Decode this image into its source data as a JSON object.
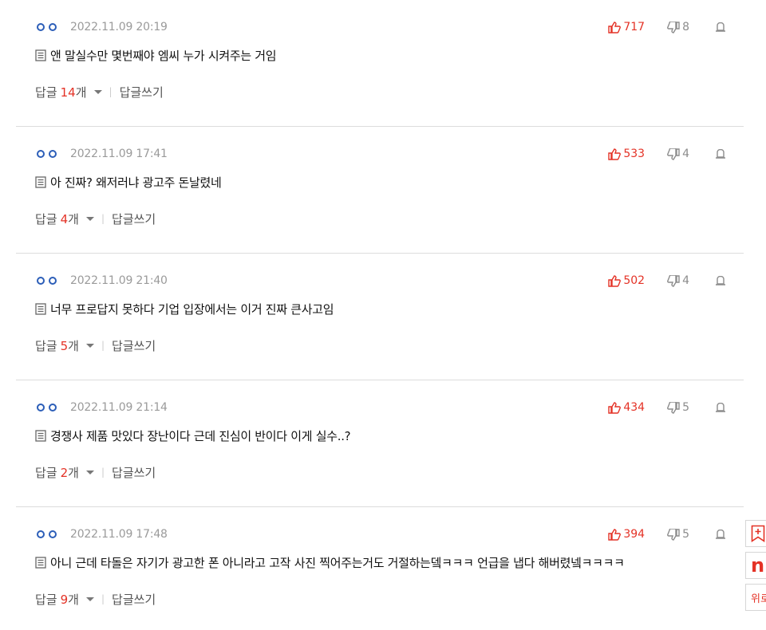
{
  "comments": [
    {
      "date": "2022.11.09 20:19",
      "text": "앤 말실수만 몇번째야 엠씨 누가 시켜주는 거임",
      "likes": "717",
      "dislikes": "8",
      "reply_label": "답글",
      "reply_count": "14",
      "reply_unit": "개",
      "write_reply": "답글쓰기"
    },
    {
      "date": "2022.11.09 17:41",
      "text": "아 진짜? 왜저러냐 광고주 돈날렸네",
      "likes": "533",
      "dislikes": "4",
      "reply_label": "답글",
      "reply_count": "4",
      "reply_unit": "개",
      "write_reply": "답글쓰기"
    },
    {
      "date": "2022.11.09 21:40",
      "text": "너무 프로답지 못하다 기업 입장에서는 이거 진짜 큰사고임",
      "likes": "502",
      "dislikes": "4",
      "reply_label": "답글",
      "reply_count": "5",
      "reply_unit": "개",
      "write_reply": "답글쓰기"
    },
    {
      "date": "2022.11.09 21:14",
      "text": "경쟁사 제품 맛있다 장난이다 근데 진심이 반이다 이게 실수..?",
      "likes": "434",
      "dislikes": "5",
      "reply_label": "답글",
      "reply_count": "2",
      "reply_unit": "개",
      "write_reply": "답글쓰기"
    },
    {
      "date": "2022.11.09 17:48",
      "text": "아니 근데 타돌은 자기가 광고한 폰 아니라고 고작 사진 찍어주는거도 거절하는뎈ㅋㅋㅋ 언급을 냅다 해버렸넼ㅋㅋㅋㅋ",
      "likes": "394",
      "dislikes": "5",
      "reply_label": "답글",
      "reply_count": "9",
      "reply_unit": "개",
      "write_reply": "답글쓰기"
    }
  ],
  "side_tools": {
    "bookmark_icon": "bookmark-plus-icon",
    "naver_logo": "n",
    "third_label": "위로"
  },
  "colors": {
    "accent": "#e43226",
    "nick_blue": "#2c5eb8",
    "date_gray": "#9a9a9a"
  }
}
